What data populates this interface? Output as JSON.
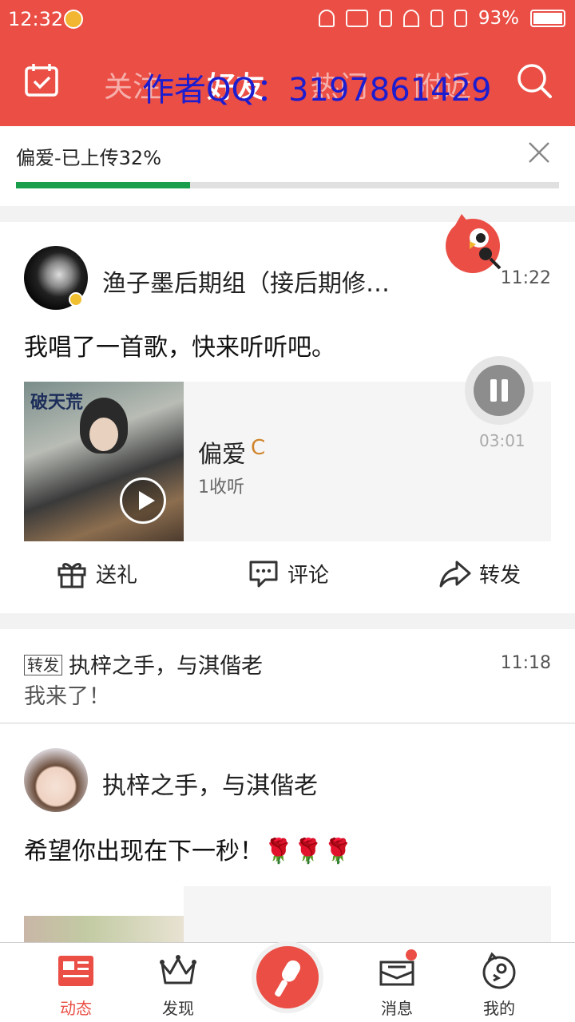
{
  "status_bar": {
    "time": "12:32",
    "battery": "93%"
  },
  "header": {
    "tabs": [
      {
        "label": "关注",
        "active": false
      },
      {
        "label": "好友",
        "active": true
      },
      {
        "label": "热门",
        "active": false
      },
      {
        "label": "附近",
        "active": false
      }
    ],
    "watermark": "作者QQ：3197861429",
    "accent_color": "#ea4e45"
  },
  "upload": {
    "text": "偏爱-已上传32%",
    "progress_percent": 32,
    "progress_color": "#1a9e4c"
  },
  "post1": {
    "username": "渔子墨后期组（接后期修…",
    "time": "11:22",
    "text": "我唱了一首歌，快来听听吧。",
    "song": {
      "cover_title": "破天荒",
      "name": "偏爱",
      "badge": "C",
      "listens": "1收听",
      "duration": "03:01"
    },
    "actions": {
      "gift": "送礼",
      "comment": "评论",
      "share": "转发"
    }
  },
  "post2": {
    "tag": "转发",
    "username": "执梓之手，与淇偕老",
    "time": "11:18",
    "text": "我来了！"
  },
  "post3": {
    "username": "执梓之手，与淇偕老",
    "text": "希望你出现在下一秒！🌹🌹🌹"
  },
  "bottom_nav": {
    "feed": "动态",
    "discover": "发现",
    "messages": "消息",
    "mine": "我的"
  }
}
